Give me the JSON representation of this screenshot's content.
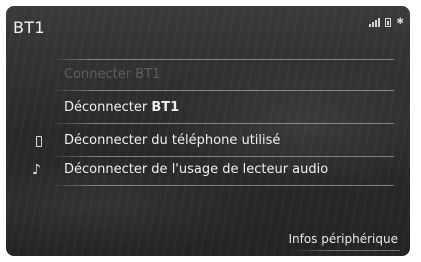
{
  "header": {
    "title": "BT1",
    "status_icons": [
      "signal-icon",
      "battery-icon",
      "bluetooth-icon"
    ]
  },
  "menu": {
    "connect": {
      "prefix": "Connecter ",
      "device": "BT1",
      "state": "disabled"
    },
    "disconnect": {
      "prefix": "Déconnecter ",
      "device": "BT1"
    },
    "disconnect_phone": {
      "label": "Déconnecter du téléphone utilisé",
      "icon": "phone-icon"
    },
    "disconnect_audio": {
      "label": "Déconnecter de l'usage de lecteur audio",
      "icon": "music-note-icon"
    }
  },
  "footer": {
    "info_label": "Infos périphérique"
  }
}
